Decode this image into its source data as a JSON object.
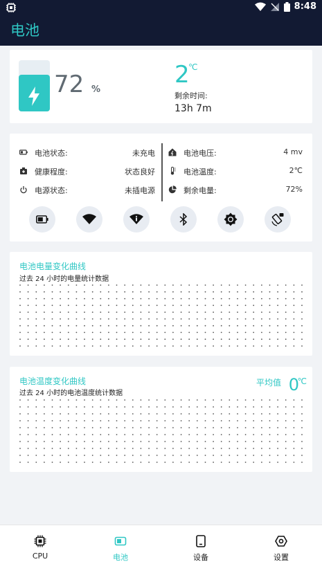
{
  "status_bar": {
    "time": "8:48"
  },
  "app": {
    "title": "电池",
    "accent": "#2fc7c4",
    "header_bg": "#121a33"
  },
  "summary": {
    "battery_level": "72",
    "battery_unit": "%",
    "battery_fraction": 0.72,
    "temperature": "2",
    "temperature_unit": "℃",
    "remaining_label": "剩余时间:",
    "remaining_value": "13h 7m"
  },
  "info": {
    "left": [
      {
        "icon": "battery-icon",
        "label": "电池状态:",
        "value": "未充电"
      },
      {
        "icon": "health-icon",
        "label": "健康程度:",
        "value": "状态良好"
      },
      {
        "icon": "power-icon",
        "label": "电源状态:",
        "value": "未插电源"
      }
    ],
    "right": [
      {
        "icon": "home-voltage-icon",
        "label": "电池电压:",
        "value": "4 mv"
      },
      {
        "icon": "thermometer-icon",
        "label": "电池温度:",
        "value": "2℃"
      },
      {
        "icon": "pie-chart-icon",
        "label": "剩余电量:",
        "value": "72%"
      }
    ],
    "quick_buttons": [
      "battery-icon",
      "wifi-icon",
      "wifi-info-icon",
      "bluetooth-icon",
      "brightness-icon",
      "screen-rotation-icon"
    ]
  },
  "level_chart": {
    "title": "电池电量变化曲线",
    "subtitle": "过去 24 小时的电量统计数据"
  },
  "temp_chart": {
    "title": "电池温度变化曲线",
    "subtitle": "过去 24 小时的电池温度统计数据",
    "avg_label": "平均值",
    "avg_value": "0",
    "avg_unit": "℃"
  },
  "bottom_nav": [
    {
      "icon": "cpu-icon",
      "label": "CPU",
      "active": false
    },
    {
      "icon": "battery-icon",
      "label": "电池",
      "active": true
    },
    {
      "icon": "device-icon",
      "label": "设备",
      "active": false
    },
    {
      "icon": "settings-icon",
      "label": "设置",
      "active": false
    }
  ]
}
